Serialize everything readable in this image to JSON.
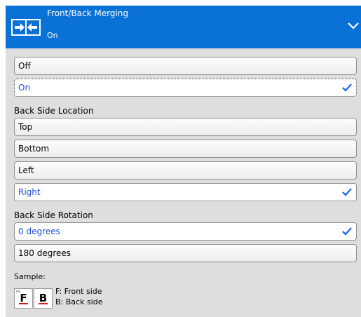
{
  "header": {
    "title": "Front/Back Merging",
    "value": "On",
    "icon": "merge-arrows-icon",
    "background_color": "#0a71d6"
  },
  "merging_options": [
    {
      "label": "Off",
      "selected": false
    },
    {
      "label": "On",
      "selected": true
    }
  ],
  "back_side_location": {
    "label": "Back Side Location",
    "options": [
      {
        "label": "Top",
        "selected": false
      },
      {
        "label": "Bottom",
        "selected": false
      },
      {
        "label": "Left",
        "selected": false
      },
      {
        "label": "Right",
        "selected": true
      }
    ]
  },
  "back_side_rotation": {
    "label": "Back Side Rotation",
    "options": [
      {
        "label": "0 degrees",
        "selected": true
      },
      {
        "label": "180 degrees",
        "selected": false
      }
    ]
  },
  "sample": {
    "label": "Sample:",
    "front_letter": "F",
    "back_letter": "B",
    "front_desc": "F: Front side",
    "back_desc": "B: Back side"
  },
  "colors": {
    "selected_text": "#1f4ddb",
    "check": "#1f6fe0"
  }
}
